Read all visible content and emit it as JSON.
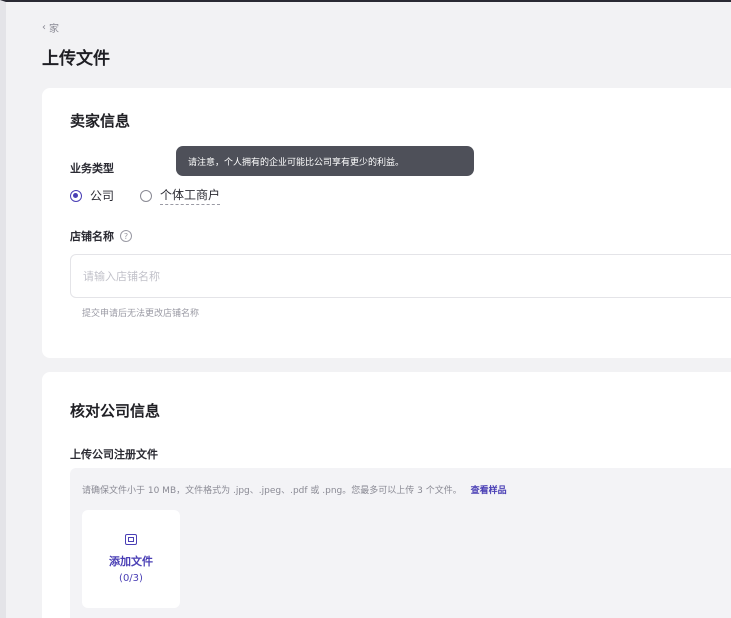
{
  "breadcrumb": {
    "chevron": "‹",
    "label": "家"
  },
  "page_title": "上传文件",
  "seller_info": {
    "title": "卖家信息",
    "business_type": {
      "label": "业务类型",
      "options": [
        {
          "label": "公司",
          "checked": true
        },
        {
          "label": "个体工商户",
          "checked": false
        }
      ],
      "tooltip": "请注意，个人拥有的企业可能比公司享有更少的利益。"
    },
    "store_name": {
      "label": "店铺名称",
      "help_icon": "?",
      "placeholder": "请输入店铺名称",
      "value": "",
      "hint": "提交申请后无法更改店铺名称"
    }
  },
  "verify_company": {
    "title": "核对公司信息",
    "upload": {
      "label": "上传公司注册文件",
      "note": "请确保文件小于 10 MB，文件格式为 .jpg、.jpeg、.pdf 或 .png。您最多可以上传 3 个文件。",
      "sample_link": "查看样品",
      "add_label": "添加文件",
      "count": "(0/3)"
    }
  },
  "colors": {
    "accent": "#4a3fb5",
    "tooltip_bg": "#4e5059",
    "page_bg": "#f2f2f4"
  },
  "icons": {
    "back": "chevron-left-icon",
    "help": "help-circle-icon",
    "file": "image-file-icon"
  }
}
